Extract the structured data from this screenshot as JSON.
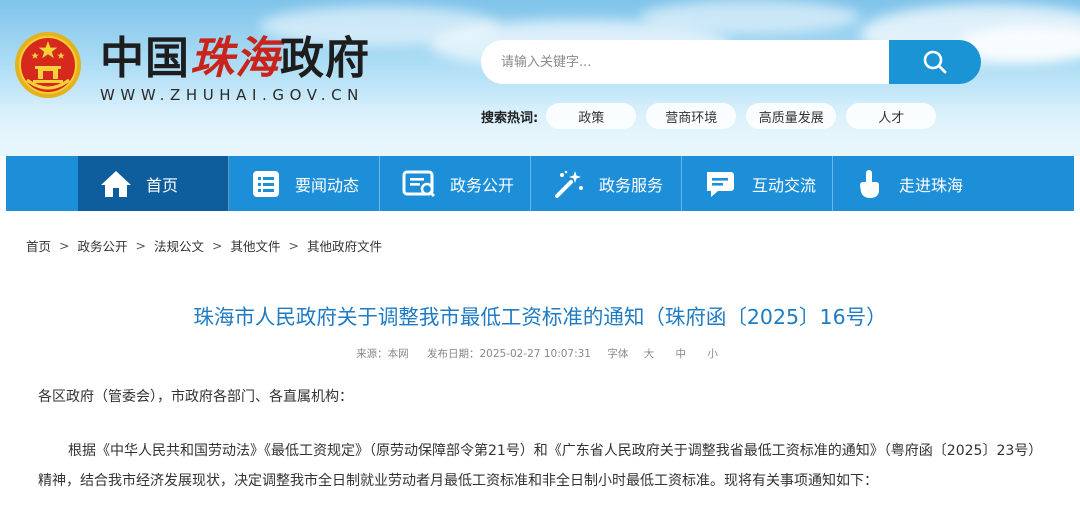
{
  "header": {
    "title_prefix": "中国",
    "title_city": "珠海",
    "title_suffix": "政府",
    "url": "WWW.ZHUHAI.GOV.CN",
    "search": {
      "placeholder": "请输入关键字..."
    },
    "hot_label": "搜索热词:",
    "hot_tags": [
      "政策",
      "营商环境",
      "高质量发展",
      "人才"
    ]
  },
  "nav": {
    "items": [
      {
        "label": "首页",
        "icon": "home-icon"
      },
      {
        "label": "要闻动态",
        "icon": "news-list-icon"
      },
      {
        "label": "政务公开",
        "icon": "document-icon"
      },
      {
        "label": "政务服务",
        "icon": "magic-wand-icon"
      },
      {
        "label": "互动交流",
        "icon": "chat-bubble-icon"
      },
      {
        "label": "走进珠海",
        "icon": "hand-pointer-icon"
      }
    ],
    "active_index": 0
  },
  "breadcrumb": [
    "首页",
    "政务公开",
    "法规公文",
    "其他文件",
    "其他政府文件"
  ],
  "breadcrumb_separator": ">",
  "article": {
    "title": "珠海市人民政府关于调整我市最低工资标准的通知（珠府函〔2025〕16号）",
    "meta": {
      "source": "来源：本网",
      "date": "发布日期：2025-02-27 10:07:31",
      "font_label": "字体",
      "font_sizes": [
        "大",
        "中",
        "小"
      ]
    },
    "salutation": "各区政府（管委会），市政府各部门、各直属机构：",
    "body": "根据《中华人民共和国劳动法》《最低工资规定》（原劳动保障部令第21号）和《广东省人民政府关于调整我省最低工资标准的通知》（粤府函〔2025〕23号）精神，结合我市经济发展现状，决定调整我市全日制就业劳动者月最低工资标准和非全日制小时最低工资标准。现将有关事项通知如下："
  },
  "colors": {
    "nav_bg": "#1d8fd8",
    "nav_active_bg": "#0e5e9e",
    "search_button": "#1b94d6",
    "title_blue": "#1e7bc4",
    "brand_red": "#c8241c"
  }
}
